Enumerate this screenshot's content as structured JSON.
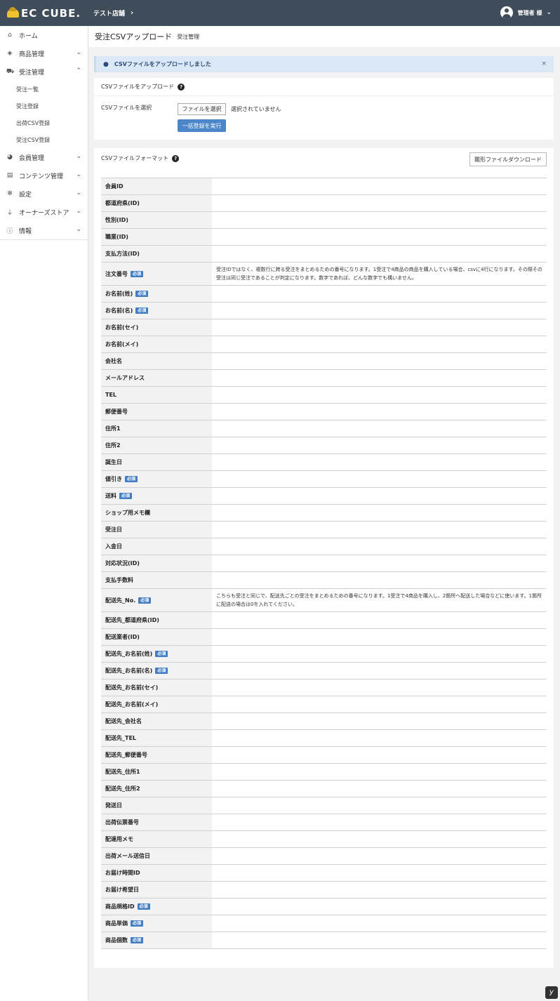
{
  "header": {
    "logo_text": "EC CUBE.",
    "shop_name": "テスト店舗",
    "user_name": "管理者 様"
  },
  "sidebar": {
    "items": [
      {
        "label": "ホーム",
        "icon": "home-icon",
        "glyph": "⌂",
        "arrow": ""
      },
      {
        "label": "商品管理",
        "icon": "tag-icon",
        "glyph": "◈",
        "arrow": "⌄"
      },
      {
        "label": "受注管理",
        "icon": "cart-icon",
        "glyph": "⛟",
        "arrow": "⌃"
      },
      {
        "label": "会員管理",
        "icon": "users-icon",
        "glyph": "◕",
        "arrow": "⌄"
      },
      {
        "label": "コンテンツ管理",
        "icon": "file-icon",
        "glyph": "▤",
        "arrow": "⌄"
      },
      {
        "label": "設定",
        "icon": "gear-icon",
        "glyph": "✻",
        "arrow": "⌄"
      },
      {
        "label": "オーナーズストア",
        "icon": "plug-icon",
        "glyph": "⏚",
        "arrow": "⌄"
      },
      {
        "label": "情報",
        "icon": "info-icon",
        "glyph": "ⓘ",
        "arrow": "⌄"
      }
    ],
    "order_sub": [
      "受注一覧",
      "受注登録",
      "出荷CSV登録",
      "受注CSV登録"
    ]
  },
  "page": {
    "title": "受注CSVアップロード",
    "subtitle": "受注管理"
  },
  "alert": {
    "message": "CSVファイルをアップロードしました",
    "close": "×"
  },
  "upload": {
    "header": "CSVファイルをアップロード",
    "label": "CSVファイルを選択",
    "file_button": "ファイルを選択",
    "file_status": "選択されていません",
    "run_button": "一括登録を実行"
  },
  "format": {
    "header": "CSVファイルフォーマット",
    "download_button": "雛形ファイルダウンロード",
    "required_badge": "必須",
    "rows": [
      {
        "key": "会員ID",
        "required": false,
        "desc": ""
      },
      {
        "key": "都道府県(ID)",
        "required": false,
        "desc": ""
      },
      {
        "key": "性別(ID)",
        "required": false,
        "desc": ""
      },
      {
        "key": "職業(ID)",
        "required": false,
        "desc": ""
      },
      {
        "key": "支払方法(ID)",
        "required": false,
        "desc": ""
      },
      {
        "key": "注文番号",
        "required": true,
        "desc": "受注IDではなく、複数行に跨る受注をまとめるための番号になります。1受注で4商品の商品を購入している場合、csvに4行になります。その際その受注は同じ受注であることが判定になります。数字であれば、どんな数字でも構いません。"
      },
      {
        "key": "お名前(姓)",
        "required": true,
        "desc": ""
      },
      {
        "key": "お名前(名)",
        "required": true,
        "desc": ""
      },
      {
        "key": "お名前(セイ)",
        "required": false,
        "desc": ""
      },
      {
        "key": "お名前(メイ)",
        "required": false,
        "desc": ""
      },
      {
        "key": "会社名",
        "required": false,
        "desc": ""
      },
      {
        "key": "メールアドレス",
        "required": false,
        "desc": ""
      },
      {
        "key": "TEL",
        "required": false,
        "desc": ""
      },
      {
        "key": "郵便番号",
        "required": false,
        "desc": ""
      },
      {
        "key": "住所1",
        "required": false,
        "desc": ""
      },
      {
        "key": "住所2",
        "required": false,
        "desc": ""
      },
      {
        "key": "誕生日",
        "required": false,
        "desc": ""
      },
      {
        "key": "値引き",
        "required": true,
        "desc": ""
      },
      {
        "key": "送料",
        "required": true,
        "desc": ""
      },
      {
        "key": "ショップ用メモ欄",
        "required": false,
        "desc": ""
      },
      {
        "key": "受注日",
        "required": false,
        "desc": ""
      },
      {
        "key": "入金日",
        "required": false,
        "desc": ""
      },
      {
        "key": "対応状況(ID)",
        "required": false,
        "desc": ""
      },
      {
        "key": "支払手数料",
        "required": false,
        "desc": ""
      },
      {
        "key": "配送先_No.",
        "required": true,
        "desc": "こちらも受注と同じで、配送先ごとの受注をまとめるための番号になります。1受注で4商品を購入し、2箇所へ配送した場合などに使います。1箇所に配送の場合は0を入れてください。"
      },
      {
        "key": "配送先_都道府県(ID)",
        "required": false,
        "desc": ""
      },
      {
        "key": "配送業者(ID)",
        "required": false,
        "desc": ""
      },
      {
        "key": "配送先_お名前(姓)",
        "required": true,
        "desc": ""
      },
      {
        "key": "配送先_お名前(名)",
        "required": true,
        "desc": ""
      },
      {
        "key": "配送先_お名前(セイ)",
        "required": false,
        "desc": ""
      },
      {
        "key": "配送先_お名前(メイ)",
        "required": false,
        "desc": ""
      },
      {
        "key": "配送先_会社名",
        "required": false,
        "desc": ""
      },
      {
        "key": "配送先_TEL",
        "required": false,
        "desc": ""
      },
      {
        "key": "配送先_郵便番号",
        "required": false,
        "desc": ""
      },
      {
        "key": "配送先_住所1",
        "required": false,
        "desc": ""
      },
      {
        "key": "配送先_住所2",
        "required": false,
        "desc": ""
      },
      {
        "key": "発送日",
        "required": false,
        "desc": ""
      },
      {
        "key": "出荷伝票番号",
        "required": false,
        "desc": ""
      },
      {
        "key": "配達用メモ",
        "required": false,
        "desc": ""
      },
      {
        "key": "出荷メール送信日",
        "required": false,
        "desc": ""
      },
      {
        "key": "お届け時間ID",
        "required": false,
        "desc": ""
      },
      {
        "key": "お届け希望日",
        "required": false,
        "desc": ""
      },
      {
        "key": "商品規格ID",
        "required": true,
        "desc": ""
      },
      {
        "key": "商品単価",
        "required": true,
        "desc": ""
      },
      {
        "key": "商品個数",
        "required": true,
        "desc": ""
      }
    ]
  },
  "footer": {
    "corner_badge": "y"
  }
}
